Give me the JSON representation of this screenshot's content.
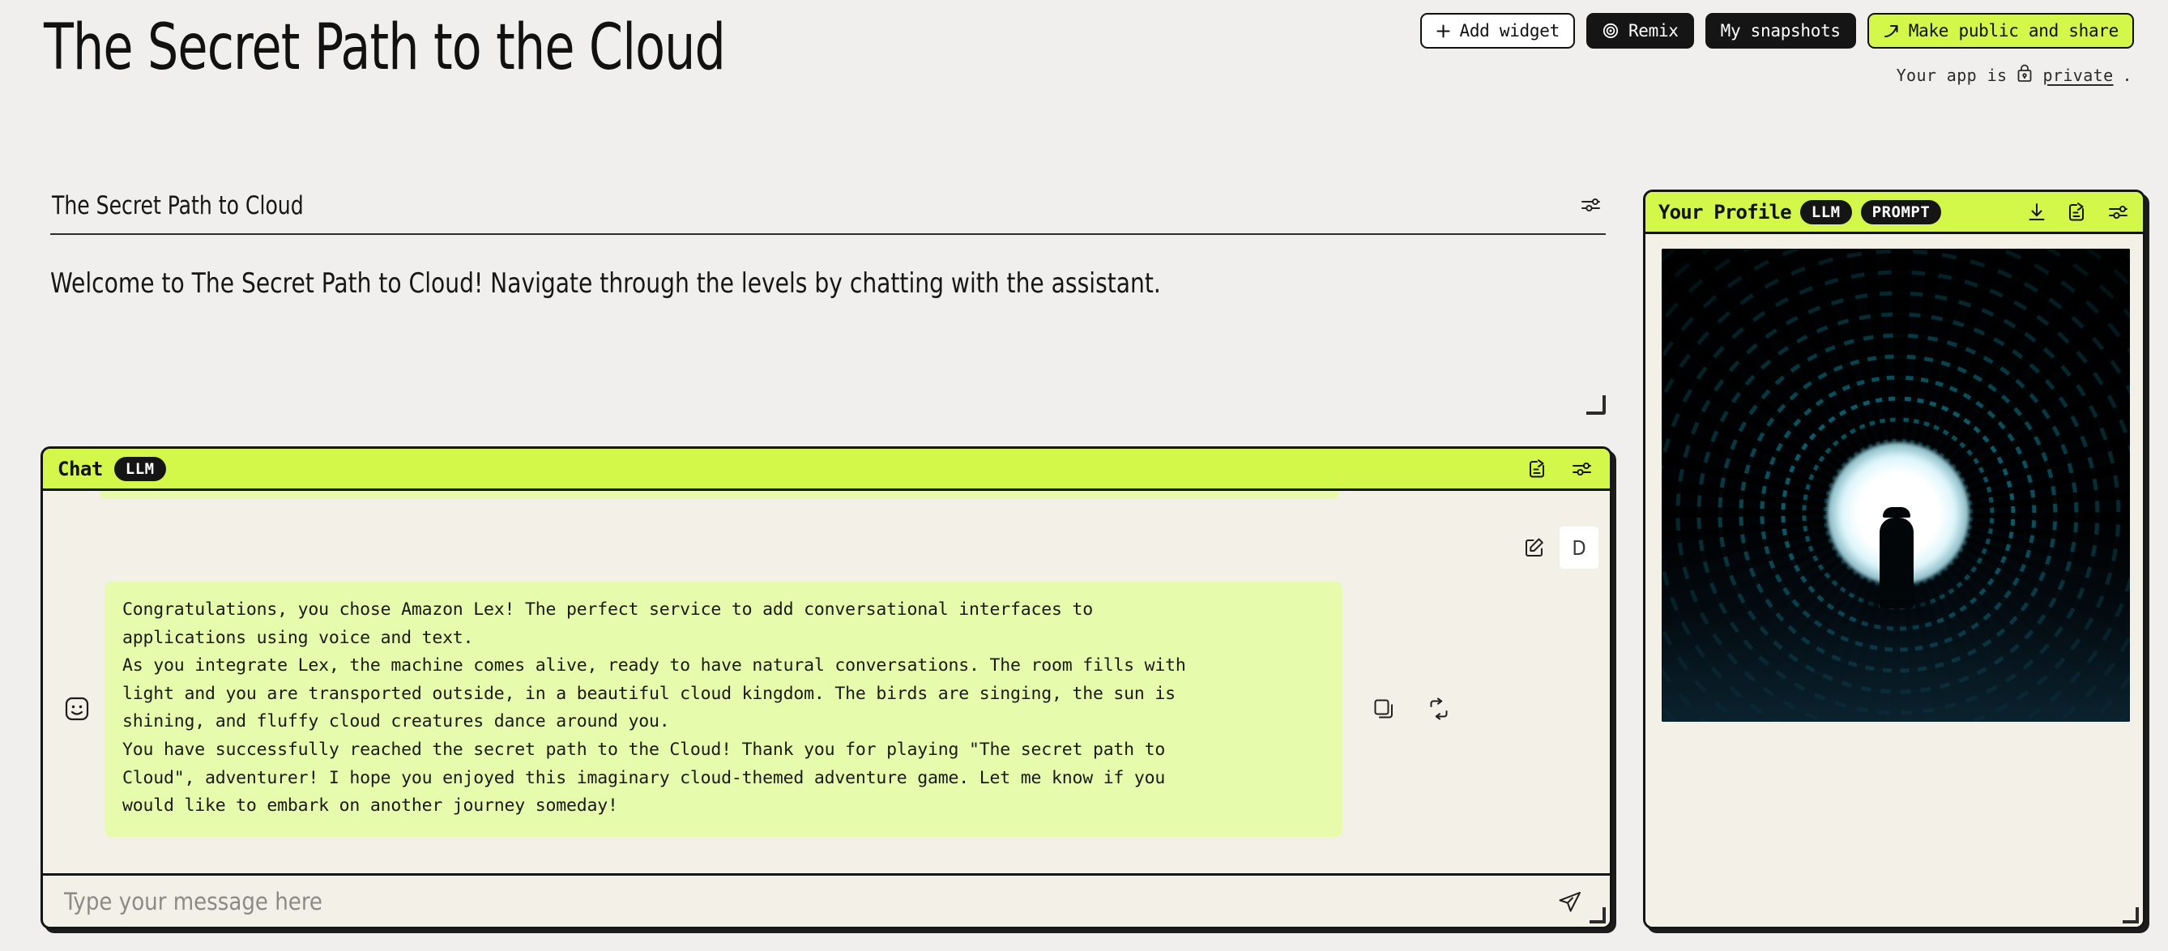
{
  "header": {
    "title": "The Secret Path to the Cloud",
    "buttons": {
      "add_widget": "Add widget",
      "remix": "Remix",
      "my_snapshots": "My snapshots",
      "make_public": "Make public and share"
    },
    "privacy": {
      "prefix": "Your app is",
      "link": "private",
      "suffix": "."
    }
  },
  "text_widget": {
    "title": "The Secret Path to Cloud",
    "body": "Welcome to The Secret Path to Cloud! Navigate through the levels by chatting with the assistant."
  },
  "chat_widget": {
    "title": "Chat",
    "badge": "LLM",
    "user_avatar": "D",
    "assistant_message": "Congratulations, you chose Amazon Lex! The perfect service to add conversational interfaces to\napplications using voice and text.\nAs you integrate Lex, the machine comes alive, ready to have natural conversations. The room fills with\nlight and you are transported outside, in a beautiful cloud kingdom. The birds are singing, the sun is\nshining, and fluffy cloud creatures dance around you.\nYou have successfully reached the secret path to the Cloud! Thank you for playing \"The secret path to\nCloud\", adventurer! I hope you enjoyed this imaginary cloud-themed adventure game. Let me know if you\nwould like to embark on another journey someday!",
    "input_placeholder": "Type your message here",
    "input_value": ""
  },
  "profile_widget": {
    "title": "Your Profile",
    "badges": [
      "LLM",
      "PROMPT"
    ]
  },
  "colors": {
    "page_background": "#f0efed",
    "accent_green": "#d4f84a",
    "bubble_green": "#e7fbad",
    "panel_cream": "#f2f0e7",
    "ink": "#151515",
    "tunnel_cyan": "#1ac8e6"
  }
}
